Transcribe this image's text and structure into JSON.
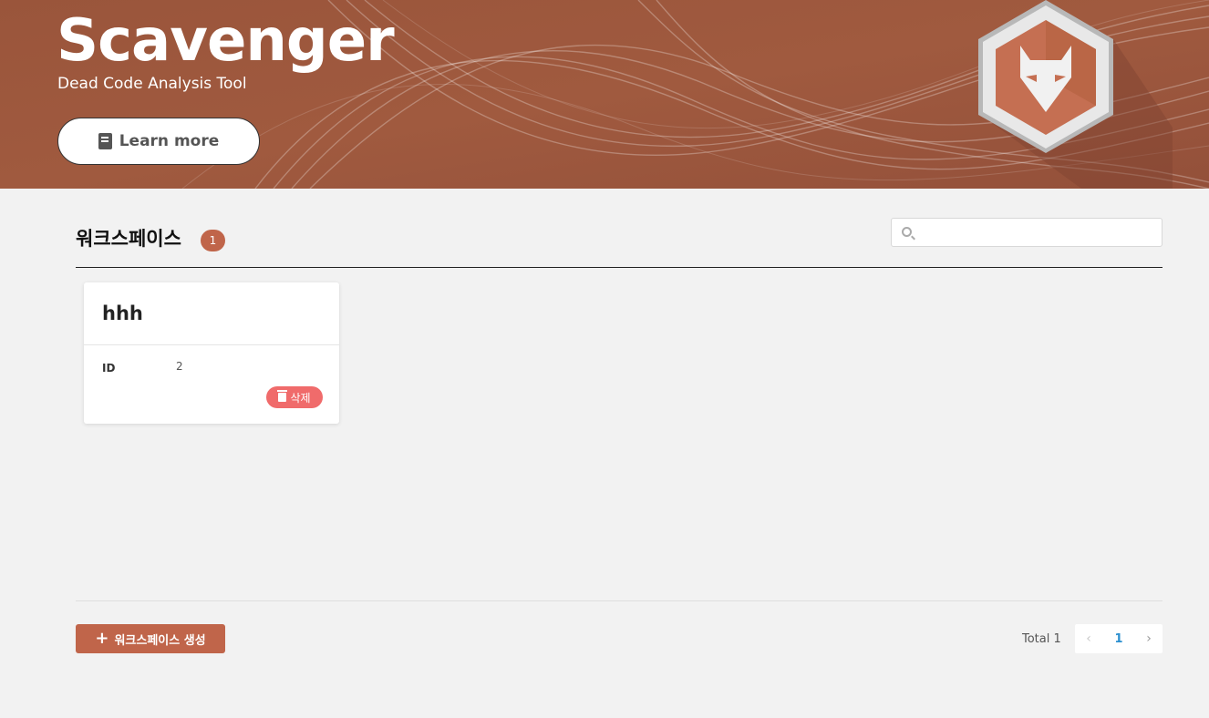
{
  "banner": {
    "title": "Scavenger",
    "subtitle": "Dead Code Analysis Tool",
    "learn_more_label": "Learn more",
    "bg_color": "#98533a"
  },
  "workspaces": {
    "title": "워크스페이스",
    "count": "1",
    "search_placeholder": "",
    "items": [
      {
        "name": "hhh",
        "id_label": "ID",
        "id_value": "2",
        "delete_label": "삭제"
      }
    ]
  },
  "footer": {
    "create_label": "워크스페이스 생성",
    "total_label": "Total 1",
    "current_page": "1",
    "prev_icon": "‹",
    "next_icon": "›"
  },
  "colors": {
    "accent": "#c0654a",
    "danger": "#f06b6b",
    "link": "#2b8fcf"
  }
}
